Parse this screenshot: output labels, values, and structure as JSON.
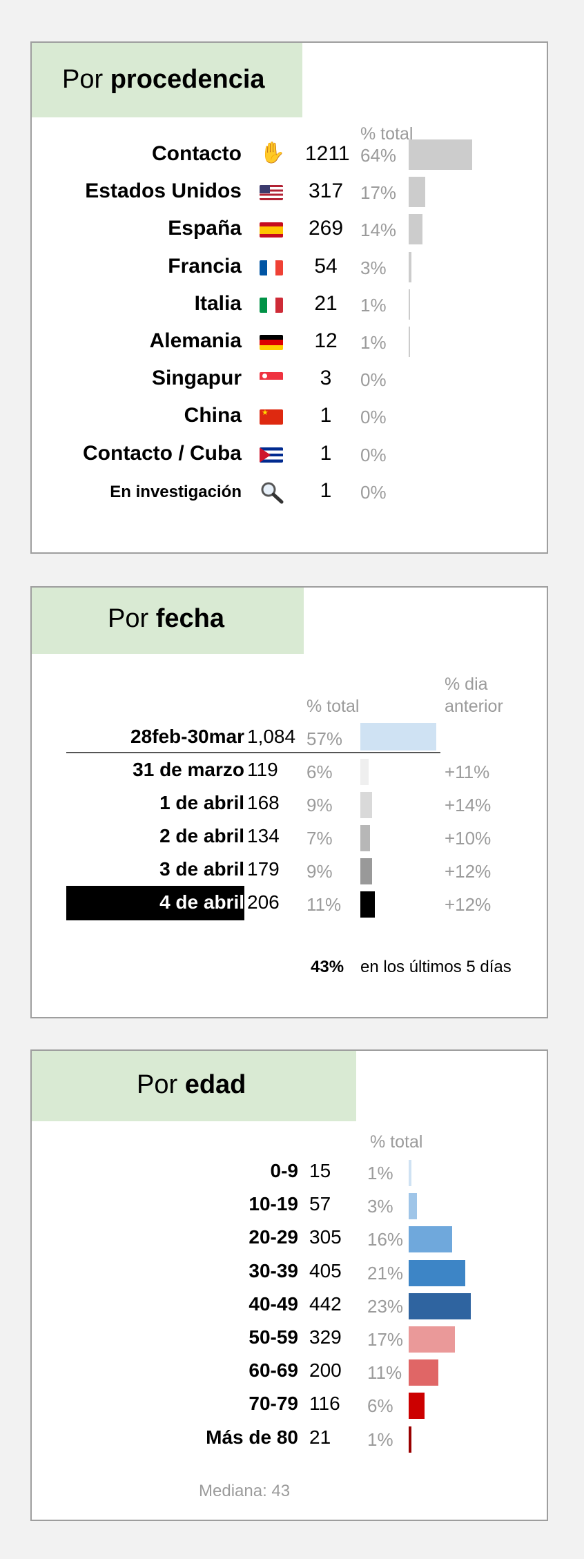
{
  "procedencia": {
    "title_prefix": "Por ",
    "title_bold": "procedencia",
    "pct_header": "% total",
    "bar_color": "#cccccc",
    "chart_data": {
      "type": "bar",
      "categories": [
        "Contacto",
        "Estados Unidos",
        "España",
        "Francia",
        "Italia",
        "Alemania",
        "Singapur",
        "China",
        "Contacto / Cuba",
        "En investigación"
      ],
      "values": [
        1211,
        317,
        269,
        54,
        21,
        12,
        3,
        1,
        1,
        1
      ],
      "pct_labels": [
        "64%",
        "17%",
        "14%",
        "3%",
        "1%",
        "1%",
        "0%",
        "0%",
        "0%",
        "0%"
      ],
      "pct_values": [
        64,
        17,
        14,
        3,
        1,
        1,
        0,
        0,
        0,
        0
      ],
      "icons": [
        "raised-hand-icon",
        "us-flag-icon",
        "spain-flag-icon",
        "france-flag-icon",
        "italy-flag-icon",
        "germany-flag-icon",
        "singapore-flag-icon",
        "china-flag-icon",
        "cuba-flag-icon",
        "magnifier-icon"
      ]
    }
  },
  "fecha": {
    "title_prefix": "Por ",
    "title_bold": "fecha",
    "pct_header": "% total",
    "prev_header_line1": "% dia",
    "prev_header_line2": "anterior",
    "summary_value": "43%",
    "summary_text": "en los últimos 5 días",
    "chart_data": {
      "type": "bar",
      "categories": [
        "28feb-30mar",
        "31 de marzo",
        "1 de abril",
        "2 de abril",
        "3 de abril",
        "4 de abril"
      ],
      "value_labels": [
        "1,084",
        "119",
        "168",
        "134",
        "179",
        "206"
      ],
      "values": [
        1084,
        119,
        168,
        134,
        179,
        206
      ],
      "pct_labels": [
        "57%",
        "6%",
        "9%",
        "7%",
        "9%",
        "11%"
      ],
      "pct_values": [
        57,
        6,
        9,
        7,
        9,
        11
      ],
      "prev_day_change": [
        "",
        "+11%",
        "+14%",
        "+10%",
        "+12%",
        "+12%"
      ],
      "bar_colors": [
        "#cfe2f3",
        "#efefef",
        "#d9d9d9",
        "#b7b7b7",
        "#999999",
        "#000000"
      ],
      "highlighted": "4 de abril"
    }
  },
  "edad": {
    "title_prefix": "Por ",
    "title_bold": "edad",
    "pct_header": "% total",
    "median_text": "Mediana: 43",
    "chart_data": {
      "type": "bar",
      "categories": [
        "0-9",
        "10-19",
        "20-29",
        "30-39",
        "40-49",
        "50-59",
        "60-69",
        "70-79",
        "Más de 80"
      ],
      "values": [
        15,
        57,
        305,
        405,
        442,
        329,
        200,
        116,
        21
      ],
      "pct_labels": [
        "1%",
        "3%",
        "16%",
        "21%",
        "23%",
        "17%",
        "11%",
        "6%",
        "1%"
      ],
      "pct_values": [
        1,
        3,
        16,
        21,
        23,
        17,
        11,
        6,
        1
      ],
      "bar_colors": [
        "#cfe2f3",
        "#9fc5e8",
        "#6fa8dc",
        "#3d85c6",
        "#2f64a0",
        "#ea9999",
        "#e06666",
        "#cc0000",
        "#990000"
      ]
    }
  }
}
